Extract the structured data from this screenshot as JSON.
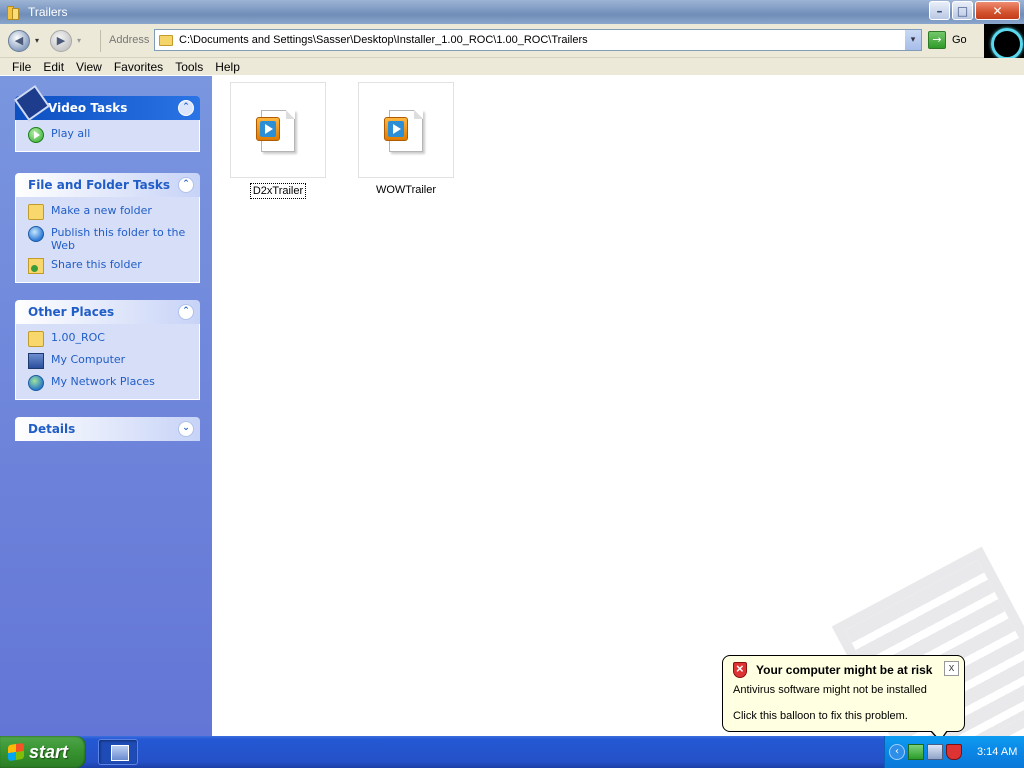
{
  "window": {
    "title": "Trailers",
    "buttons": {
      "minimize": "–",
      "maximize": "□",
      "close": "✕"
    }
  },
  "toolbar": {
    "back_glyph": "◀",
    "forward_glyph": "▶",
    "dropdown_glyph": "▾",
    "address_label": "Address",
    "address_value": "C:\\Documents and Settings\\Sasser\\Desktop\\Installer_1.00_ROC\\1.00_ROC\\Trailers",
    "go_label": "Go",
    "go_glyph": "→"
  },
  "menu": [
    "File",
    "Edit",
    "View",
    "Favorites",
    "Tools",
    "Help"
  ],
  "sidebar": {
    "video_tasks": {
      "title": "Video Tasks",
      "chevron": "⌃",
      "items": [
        {
          "label": "Play all",
          "icon": "play-icon"
        }
      ]
    },
    "file_folder_tasks": {
      "title": "File and Folder Tasks",
      "chevron": "⌃",
      "items": [
        {
          "label": "Make a new folder",
          "icon": "new-folder-icon"
        },
        {
          "label": "Publish this folder to the Web",
          "icon": "globe-icon"
        },
        {
          "label": "Share this folder",
          "icon": "share-icon"
        }
      ]
    },
    "other_places": {
      "title": "Other Places",
      "chevron": "⌃",
      "items": [
        {
          "label": "1.00_ROC",
          "icon": "folder-icon"
        },
        {
          "label": "My Computer",
          "icon": "computer-icon"
        },
        {
          "label": "My Network Places",
          "icon": "network-icon"
        }
      ]
    },
    "details": {
      "title": "Details",
      "chevron": "⌄"
    }
  },
  "files": [
    {
      "name": "D2xTrailer",
      "icon": "video-file-icon",
      "focused": true
    },
    {
      "name": "WOWTrailer",
      "icon": "video-file-icon",
      "focused": false
    }
  ],
  "balloon": {
    "title": "Your computer might be at risk",
    "line1": "Antivirus software might not be installed",
    "line2": "Click this balloon to fix this problem.",
    "close": "x"
  },
  "taskbar": {
    "start_label": "start",
    "clock": "3:14 AM",
    "tray_chevron": "‹"
  },
  "colors": {
    "taskpane": "#6b85dc",
    "panel_header_text": "#215dc6",
    "balloon_bg": "#ffffe1",
    "taskbar": "#2458d4",
    "start_button": "#37932f"
  }
}
